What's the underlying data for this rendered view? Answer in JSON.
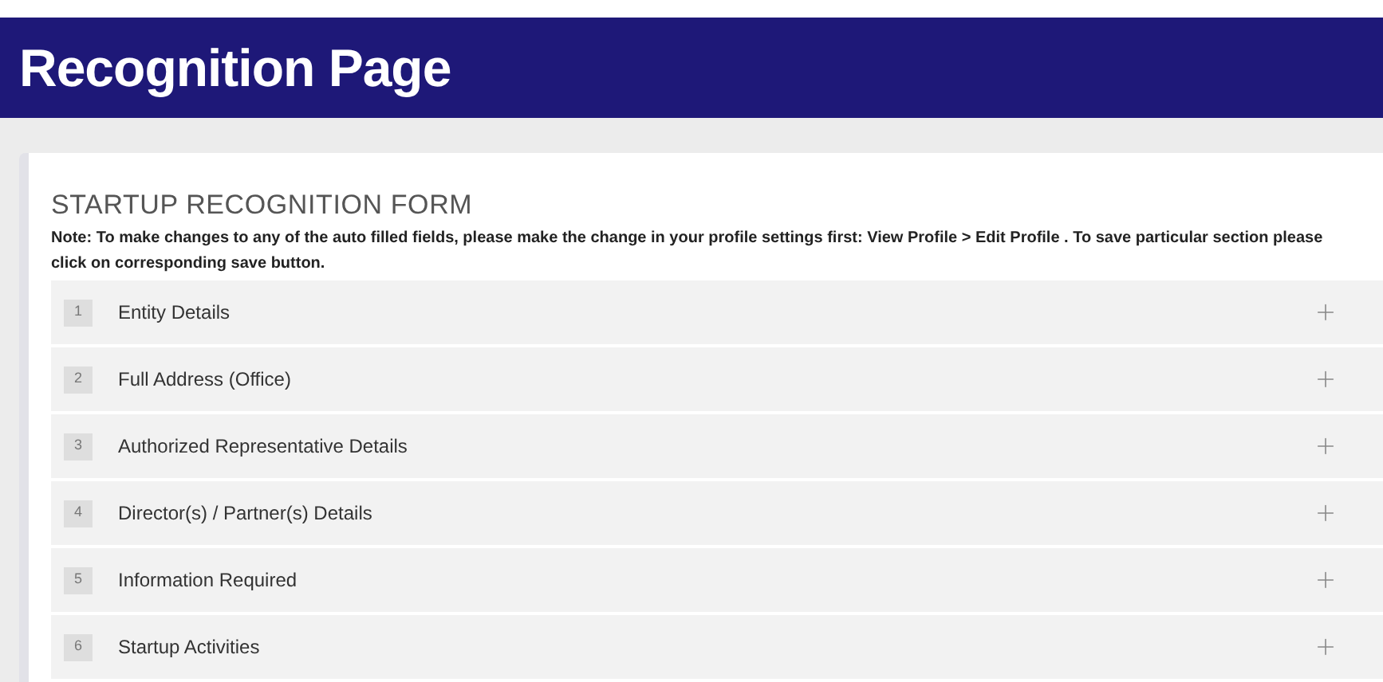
{
  "header": {
    "title": "Recognition Page"
  },
  "form": {
    "title": "STARTUP RECOGNITION FORM",
    "note": "Note: To make changes to any of the auto filled fields, please make the change in your profile settings first: View Profile > Edit Profile . To save particular section please click on corresponding save button.",
    "sections": [
      {
        "number": "1",
        "label": "Entity Details",
        "expanded": false
      },
      {
        "number": "2",
        "label": "Full Address (Office)",
        "expanded": false
      },
      {
        "number": "3",
        "label": "Authorized Representative Details",
        "expanded": false
      },
      {
        "number": "4",
        "label": "Director(s) / Partner(s) Details",
        "expanded": false
      },
      {
        "number": "5",
        "label": "Information Required",
        "expanded": false
      },
      {
        "number": "6",
        "label": "Startup Activities",
        "expanded": false
      }
    ]
  }
}
